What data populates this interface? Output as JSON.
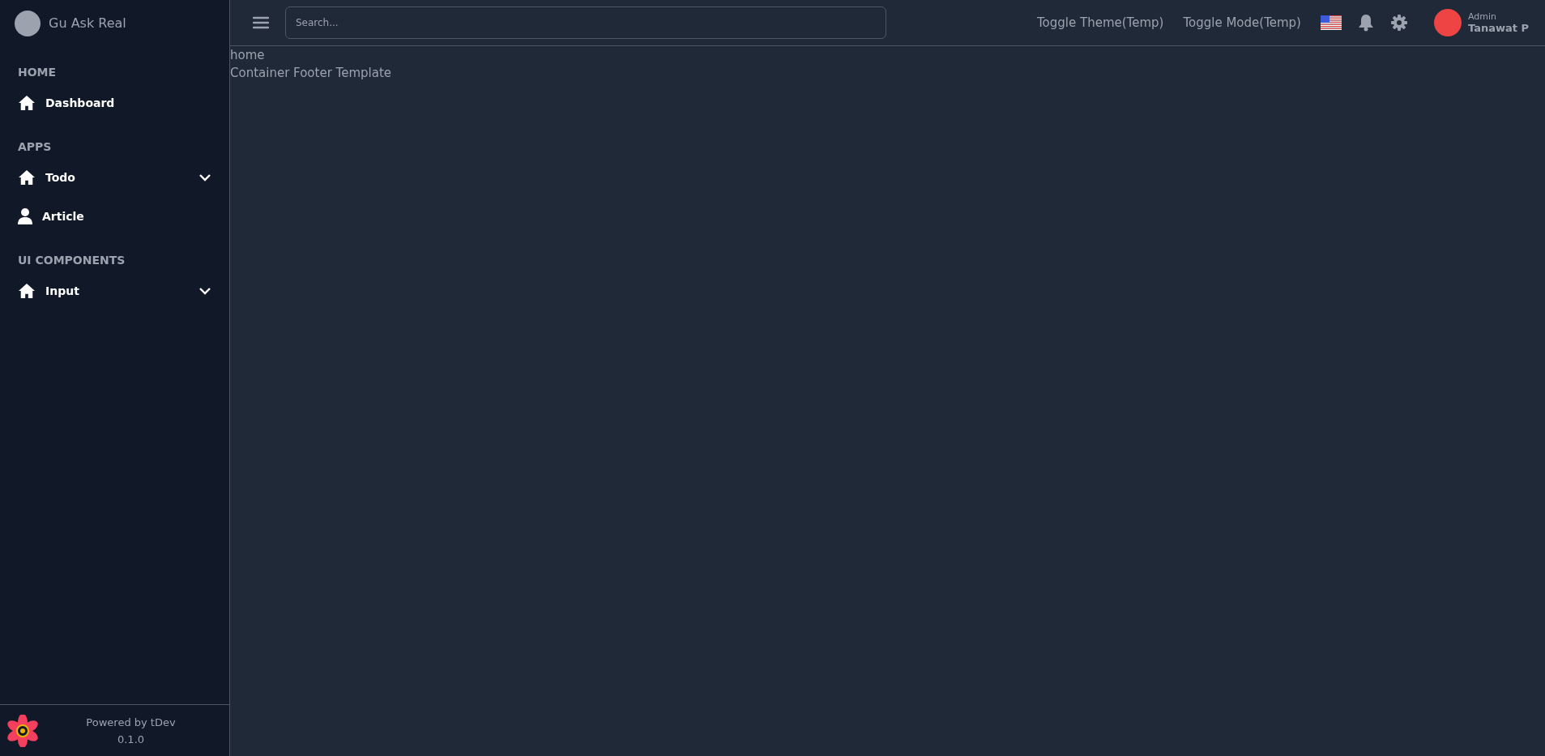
{
  "sidebar": {
    "brand": "Gu Ask Real",
    "sections": [
      {
        "title": "HOME",
        "items": [
          {
            "label": "Dashboard",
            "kind": "home",
            "expandable": false
          }
        ]
      },
      {
        "title": "APPS",
        "items": [
          {
            "label": "Todo",
            "kind": "home",
            "expandable": true
          },
          {
            "label": "Article",
            "kind": "user",
            "expandable": false
          }
        ]
      },
      {
        "title": "UI COMPONENTS",
        "items": [
          {
            "label": "Input",
            "kind": "home",
            "expandable": true
          }
        ]
      }
    ],
    "footer": {
      "powered_by": "Powered by tDev",
      "version": "0.1.0"
    }
  },
  "header": {
    "search": {
      "placeholder": "Search..."
    },
    "links": [
      "Toggle Theme(Temp)",
      "Toggle Mode(Temp)"
    ],
    "user": {
      "role": "Admin",
      "name": "Tanawat P"
    }
  },
  "content": {
    "lines": [
      "home",
      "Container Footer Template"
    ]
  }
}
